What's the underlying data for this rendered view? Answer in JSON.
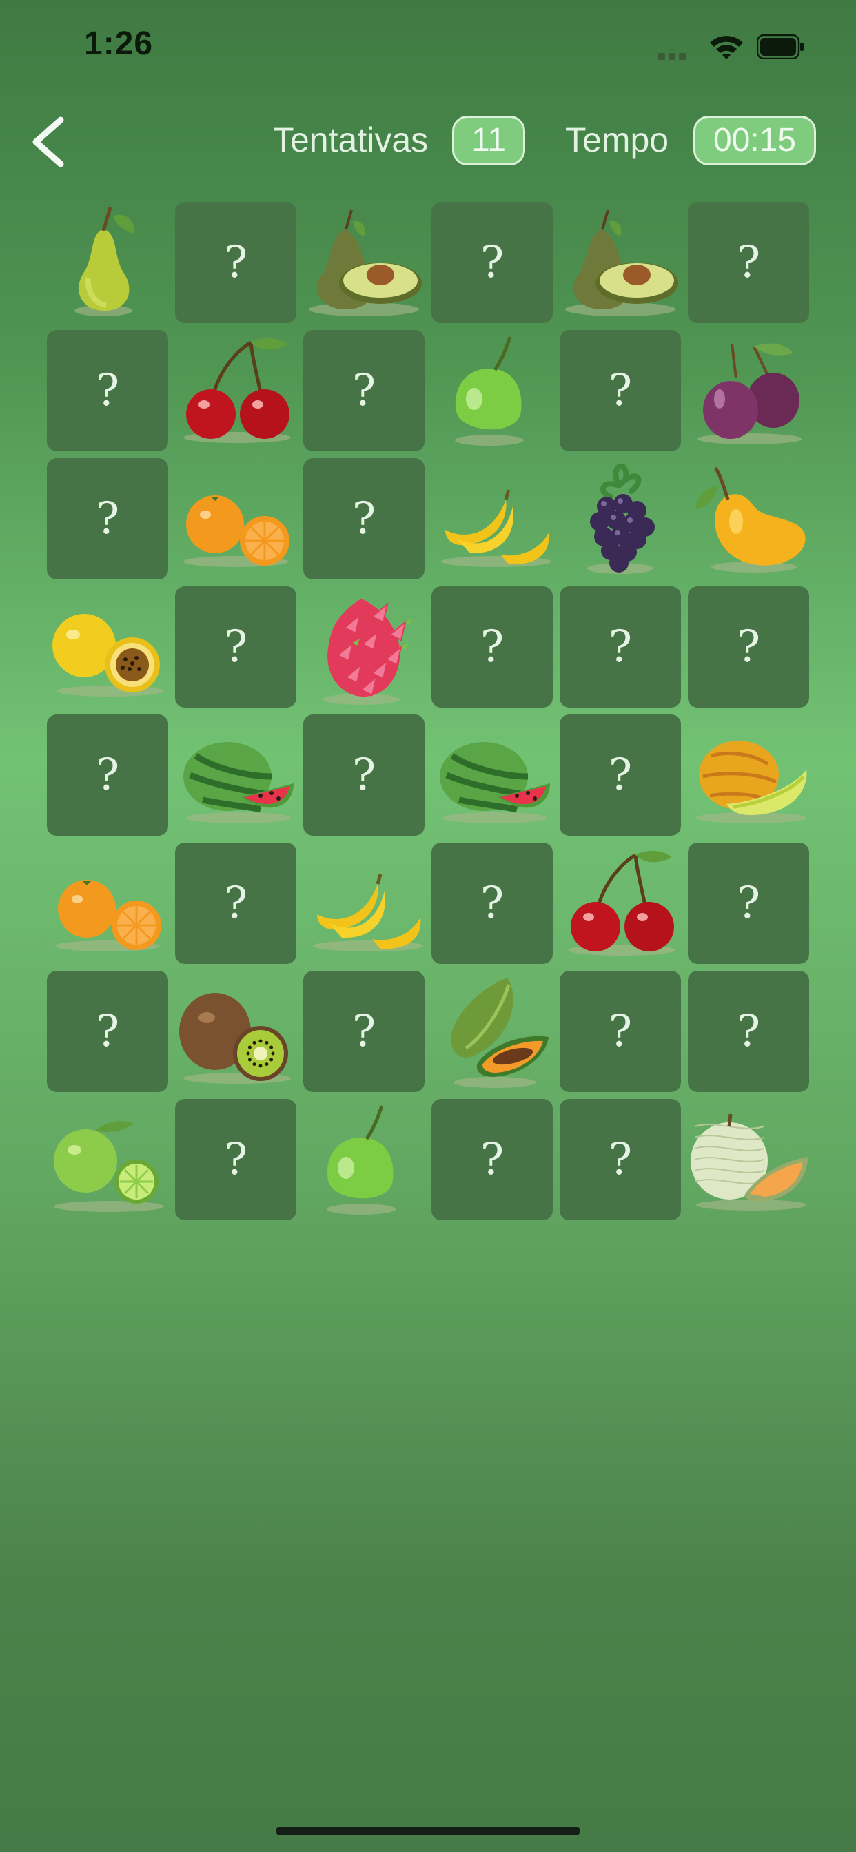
{
  "status_bar": {
    "time": "1:26",
    "icons": [
      "cellular-signal-icon",
      "wifi-icon",
      "battery-icon"
    ]
  },
  "header": {
    "back_icon": "chevron-left-icon",
    "attempts_label": "Tentativas",
    "attempts_value": "11",
    "time_label": "Tempo",
    "time_value": "00:15"
  },
  "board": {
    "columns": 6,
    "rows": 8,
    "hidden_symbol": "?",
    "cards": [
      "pear",
      "?",
      "avocado",
      "?",
      "avocado",
      "?",
      "?",
      "cherry",
      "?",
      "guava",
      "?",
      "plum",
      "?",
      "orange",
      "?",
      "banana",
      "blackberry",
      "mango",
      "passion-fruit",
      "?",
      "dragon-fruit",
      "?",
      "?",
      "?",
      "?",
      "watermelon",
      "?",
      "watermelon",
      "?",
      "galia-melon",
      "orange",
      "?",
      "banana",
      "?",
      "cherry",
      "?",
      "?",
      "kiwi",
      "?",
      "papaya",
      "?",
      "?",
      "lime",
      "?",
      "guava",
      "?",
      "?",
      "cantaloupe"
    ]
  },
  "colors": {
    "card_hidden": "#467447",
    "pill_fill": "#7fcc7f",
    "pill_border": "#ddf0d9",
    "label_text": "#e2f1e2"
  }
}
